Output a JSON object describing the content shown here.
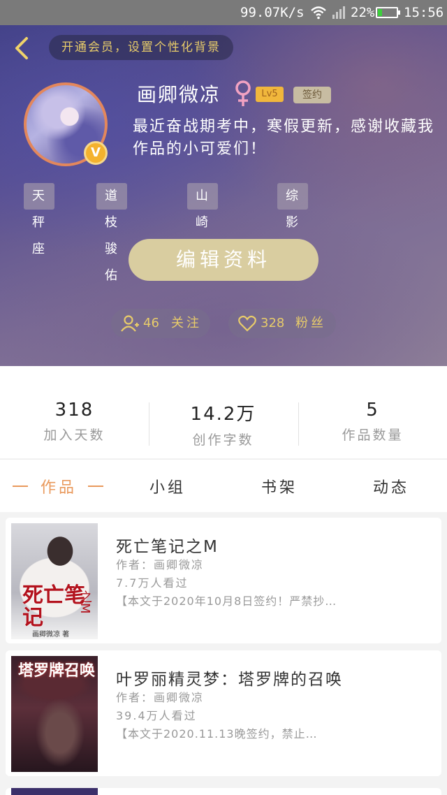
{
  "status_bar": {
    "net_speed": "99.07K/s",
    "battery_pct": "22%",
    "battery_level": 0.22,
    "time": "15:56"
  },
  "header": {
    "vip_prompt": "开通会员，设置个性化背景"
  },
  "profile": {
    "username": "画卿微凉",
    "gender_icon": "female-icon",
    "level": "Lv5",
    "sign_badge": "签约",
    "verified_badge": "V",
    "bio": "最近奋战期考中，寒假更新，感谢收藏我作品的小可爱们！",
    "tags": [
      "天秤座",
      "道枝骏佑",
      "山崎贤人",
      "综影视"
    ],
    "edit_button": "编辑资料",
    "following_count": "46",
    "following_label": "关注",
    "fans_count": "328",
    "fans_label": "粉丝"
  },
  "stats": [
    {
      "value": "318",
      "label": "加入天数"
    },
    {
      "value": "14.2万",
      "label": "创作字数"
    },
    {
      "value": "5",
      "label": "作品数量"
    }
  ],
  "tabs": [
    {
      "label": "作品",
      "active": true
    },
    {
      "label": "小组",
      "active": false
    },
    {
      "label": "书架",
      "active": false
    },
    {
      "label": "动态",
      "active": false
    }
  ],
  "works": [
    {
      "title": "死亡笔记之M",
      "author": "作者：画卿微凉",
      "views": "7.7万人看过",
      "description": "【本文于2020年10月8日签约！严禁抄…",
      "cover_title": "死亡笔记",
      "cover_subtitle": "之M",
      "cover_author": "画卿微凉 著"
    },
    {
      "title": "叶罗丽精灵梦：塔罗牌的召唤",
      "author": "作者：画卿微凉",
      "views": "39.4万人看过",
      "description": "【本文于2020.11.13晚签约，禁止…",
      "cover_title": "塔罗牌召唤"
    }
  ],
  "colors": {
    "accent": "#e9995c",
    "gold": "#e8cc6a",
    "edit_button_bg": "#d9cda0"
  }
}
